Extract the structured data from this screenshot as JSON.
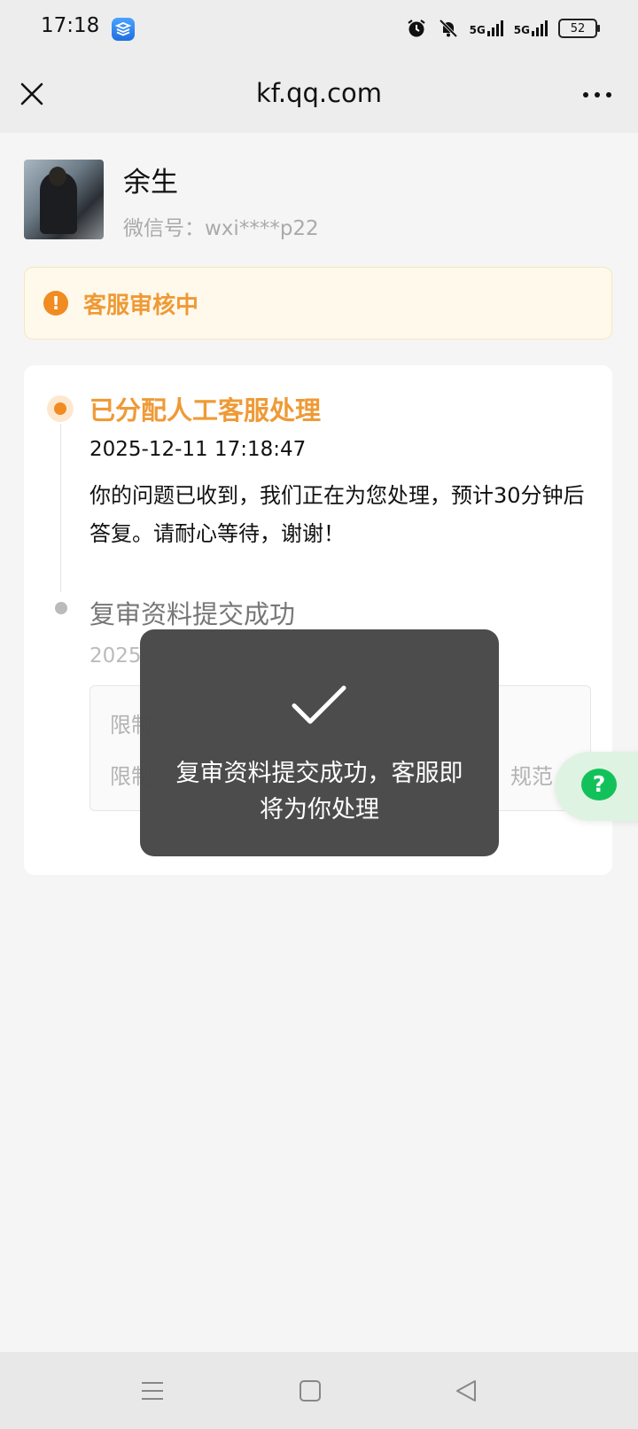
{
  "status_bar": {
    "time": "17:18",
    "signal1": "5G",
    "signal2": "5G",
    "battery": "52"
  },
  "nav": {
    "title": "kf.qq.com"
  },
  "profile": {
    "name": "余生",
    "wechat_id": "微信号：wxi****p22"
  },
  "review_banner": {
    "text": "客服审核中",
    "color": "#ef9a36"
  },
  "timeline": [
    {
      "title": "已分配人工客服处理",
      "time": "2025-12-11 17:18:47",
      "desc": "你的问题已收到，我们正在为您处理，预计30分钟后答复。请耐心等待，谢谢！"
    },
    {
      "title": "复审资料提交成功",
      "time": "2025",
      "info_line1": "限制",
      "info_line2": "限制",
      "info_tail": "规范"
    }
  ],
  "toast": {
    "message": "复审资料提交成功，客服即将为你处理"
  },
  "colors": {
    "accent": "#f08c21",
    "help_green": "#13c15b"
  }
}
